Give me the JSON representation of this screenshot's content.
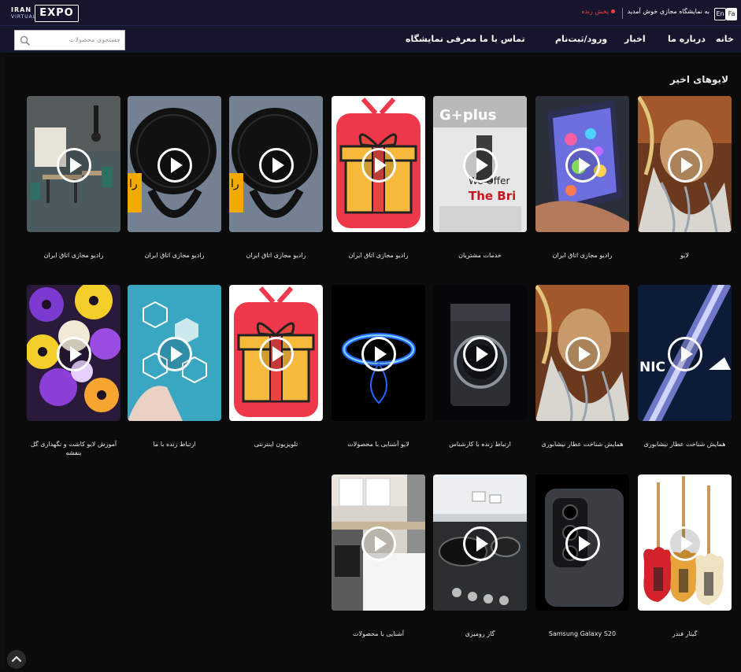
{
  "brand": {
    "iran": "IRAN",
    "virtual": "VIRTUAL",
    "expo": "EXPO"
  },
  "topbar": {
    "welcome": "به نمایشگاه مجازی خوش آمدید",
    "live": "پخش زنده",
    "lang_fa": "Fa",
    "lang_en": "En"
  },
  "search": {
    "placeholder": "جستجوی محصولات"
  },
  "nav": {
    "home": "خانه",
    "about": "درباره ما",
    "news": "اخبار",
    "login": "ورود/ثبت‌نام",
    "contact": "تماس با ما",
    "exhibition": "معرفی نمایشگاه"
  },
  "section": {
    "title": "لایوهای اخیر"
  },
  "cards": [
    {
      "title": "لایو",
      "thumb": "persian-painting"
    },
    {
      "title": "رادیو مجازی اتاق ایران",
      "thumb": "tablet-hand"
    },
    {
      "title": "خدمات مشتریان",
      "thumb": "gplus-fridge"
    },
    {
      "title": "رادیو مجازی اتاق ایران",
      "thumb": "tv-gift"
    },
    {
      "title": "رادیو مجازی اتاق ایران",
      "thumb": "microphone"
    },
    {
      "title": "رادیو مجازی اتاق ایران",
      "thumb": "microphone"
    },
    {
      "title": "رادیو مجازی اتاق ایران",
      "thumb": "restaurant-interior"
    },
    {
      "title": "همایش شناخت عطار نیشابوری",
      "thumb": "blue-stripe"
    },
    {
      "title": "همایش شناخت عطار نیشابوری",
      "thumb": "persian-painting"
    },
    {
      "title": "ارتباط زنده با کارشناس",
      "thumb": "washing-machine"
    },
    {
      "title": "لایو آشنایی با محصولات",
      "thumb": "gas-flame"
    },
    {
      "title": "تلویزیون اینترنتی",
      "thumb": "tv-gift"
    },
    {
      "title": "ارتباط زنده با ما",
      "thumb": "medical-hexagons"
    },
    {
      "title": "آموزش لایو کاشت و نگهداری گل بنفشه",
      "thumb": "pansies"
    },
    {
      "title": "گیتار فندر",
      "thumb": "guitars"
    },
    {
      "title": "Samsung Galaxy S20",
      "thumb": "smartphone"
    },
    {
      "title": "گاز رومیزی",
      "thumb": "cooktop"
    },
    {
      "title": "آشنایی با محصولات",
      "thumb": "kitchen"
    }
  ],
  "colors": {
    "header": "#15162d",
    "page": "#0b0b0b",
    "live": "#ff3b46",
    "tv_red": "#f0384b",
    "gift_yellow": "#f6b93b"
  }
}
